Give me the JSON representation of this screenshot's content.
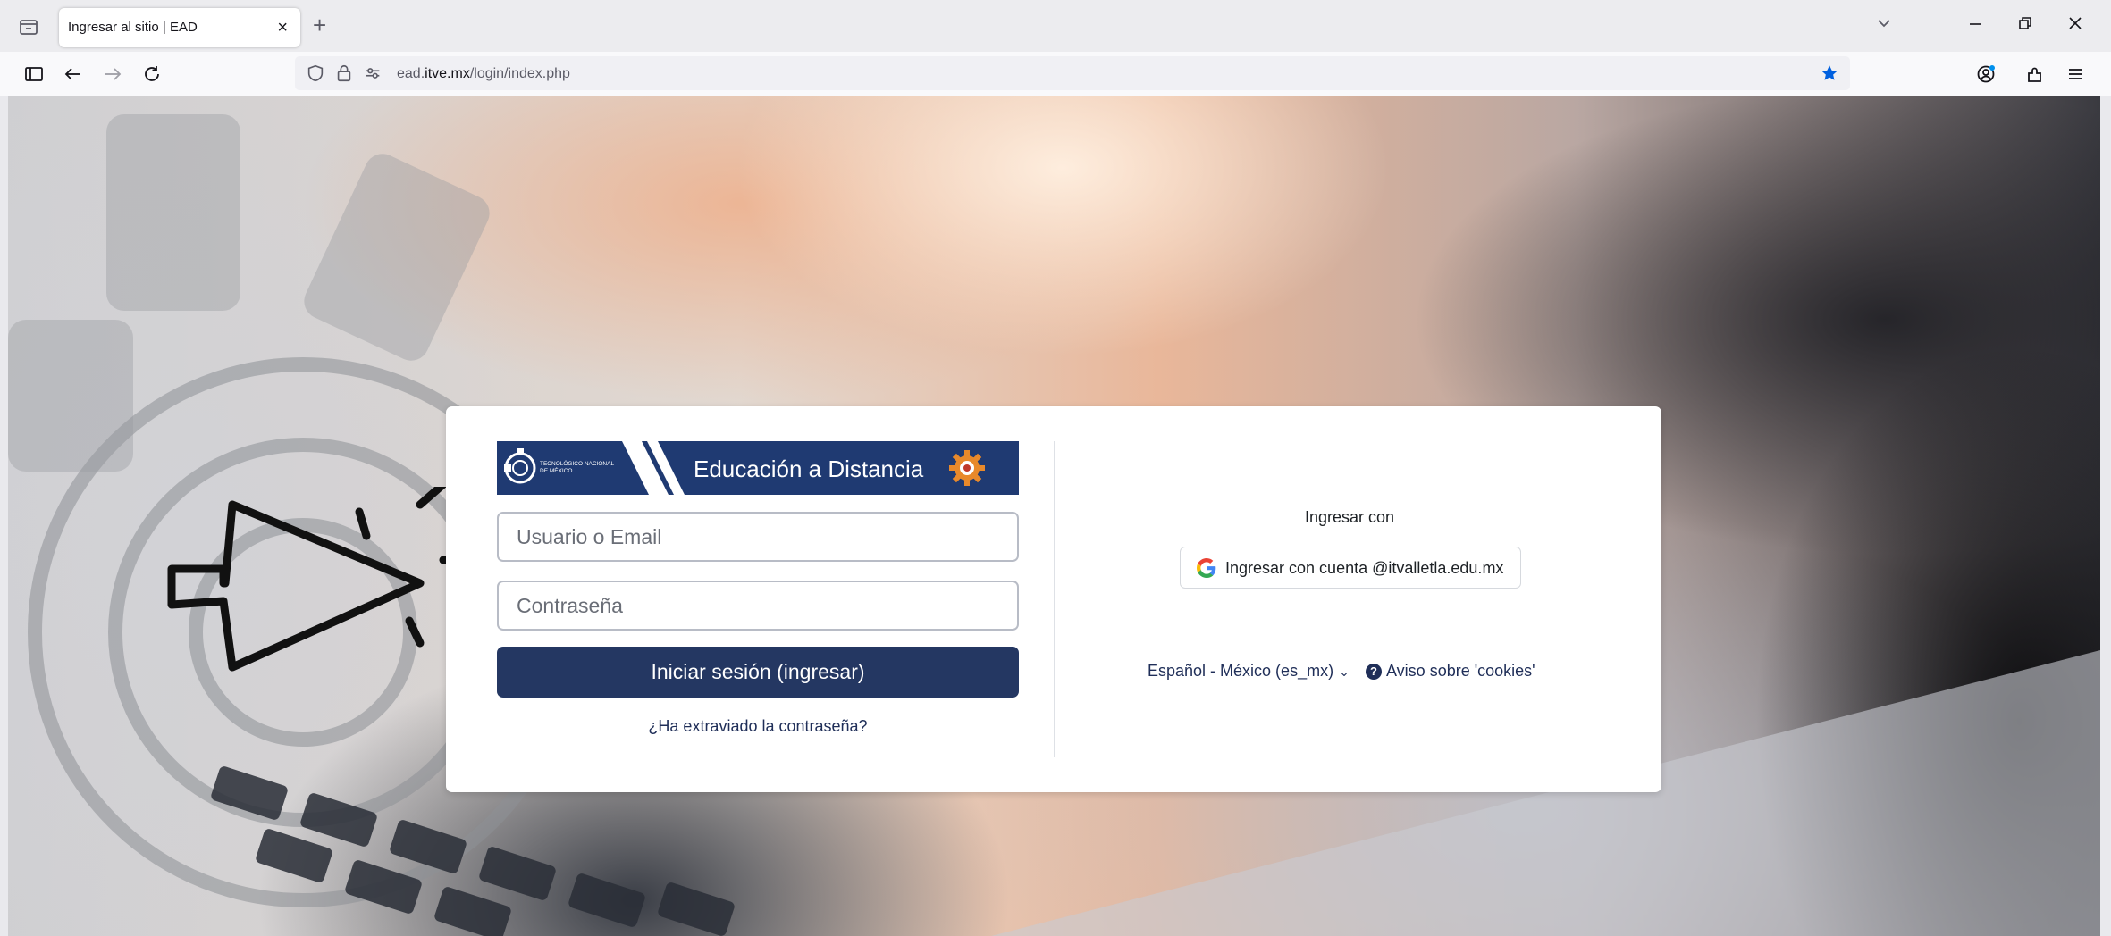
{
  "browser": {
    "tab_title": "Ingresar al sitio | EAD",
    "tab_close": "×",
    "new_tab": "+",
    "url_domain_prefix": "ead.",
    "url_domain_main": "itve.mx",
    "url_path": "/login/index.php"
  },
  "banner": {
    "logo_text": "TECNOLÓGICO NACIONAL DE MÉXICO",
    "title": "Educación a Distancia"
  },
  "login": {
    "username_placeholder": "Usuario o Email",
    "password_placeholder": "Contraseña",
    "submit_label": "Iniciar sesión (ingresar)",
    "forgot_label": "¿Ha extraviado la contraseña?"
  },
  "oauth": {
    "heading": "Ingresar con",
    "google_label": "Ingresar con cuenta @itvalletla.edu.mx"
  },
  "footer": {
    "language": "Español - México (es_mx)",
    "cookies_label": "Aviso sobre 'cookies'"
  },
  "colors": {
    "primary": "#243762",
    "banner": "#1f3a72",
    "bookmark_star": "#0060df"
  }
}
